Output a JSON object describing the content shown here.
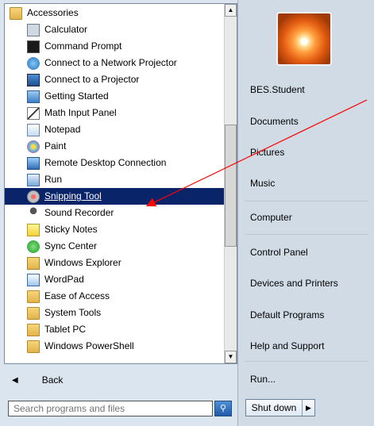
{
  "programs": [
    {
      "label": "Accessories",
      "icon": "folder-icon"
    },
    {
      "label": "Calculator",
      "icon": "calculator-icon"
    },
    {
      "label": "Command Prompt",
      "icon": "command-prompt-icon"
    },
    {
      "label": "Connect to a Network Projector",
      "icon": "network-projector-icon"
    },
    {
      "label": "Connect to a Projector",
      "icon": "projector-icon"
    },
    {
      "label": "Getting Started",
      "icon": "getting-started-icon"
    },
    {
      "label": "Math Input Panel",
      "icon": "math-input-icon"
    },
    {
      "label": "Notepad",
      "icon": "notepad-icon"
    },
    {
      "label": "Paint",
      "icon": "paint-icon"
    },
    {
      "label": "Remote Desktop Connection",
      "icon": "remote-desktop-icon"
    },
    {
      "label": "Run",
      "icon": "run-icon"
    },
    {
      "label": "Snipping Tool",
      "icon": "snipping-tool-icon"
    },
    {
      "label": "Sound Recorder",
      "icon": "microphone-icon"
    },
    {
      "label": "Sticky Notes",
      "icon": "sticky-notes-icon"
    },
    {
      "label": "Sync Center",
      "icon": "sync-center-icon"
    },
    {
      "label": "Windows Explorer",
      "icon": "windows-explorer-icon"
    },
    {
      "label": "WordPad",
      "icon": "wordpad-icon"
    },
    {
      "label": "Ease of Access",
      "icon": "folder-icon"
    },
    {
      "label": "System Tools",
      "icon": "folder-icon"
    },
    {
      "label": "Tablet PC",
      "icon": "folder-icon"
    },
    {
      "label": "Windows PowerShell",
      "icon": "folder-icon"
    }
  ],
  "selected_program": "Snipping Tool",
  "back_label": "Back",
  "search": {
    "placeholder": "Search programs and files"
  },
  "right_links": [
    "BES.Student",
    "Documents",
    "Pictures",
    "Music",
    "Computer",
    "Control Panel",
    "Devices and Printers",
    "Default Programs",
    "Help and Support",
    "Run..."
  ],
  "shutdown_label": "Shut down",
  "colors": {
    "selection": "#0a246a",
    "annotation_arrow": "#ff0000"
  }
}
